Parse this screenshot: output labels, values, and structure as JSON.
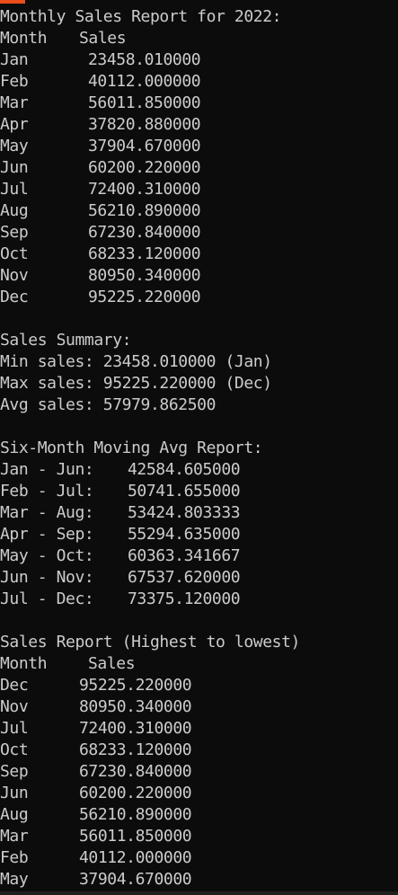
{
  "window": {
    "accent_color": "#e94e1b",
    "background": "#0c0c0c",
    "text_color": "#cccccc"
  },
  "monthly": {
    "heading": "Monthly Sales Report for 2022:",
    "col_month": "Month",
    "col_sales": "Sales",
    "rows": [
      {
        "month": "Jan",
        "sales": "23458.010000"
      },
      {
        "month": "Feb",
        "sales": "40112.000000"
      },
      {
        "month": "Mar",
        "sales": "56011.850000"
      },
      {
        "month": "Apr",
        "sales": "37820.880000"
      },
      {
        "month": "May",
        "sales": "37904.670000"
      },
      {
        "month": "Jun",
        "sales": "60200.220000"
      },
      {
        "month": "Jul",
        "sales": "72400.310000"
      },
      {
        "month": "Aug",
        "sales": "56210.890000"
      },
      {
        "month": "Sep",
        "sales": "67230.840000"
      },
      {
        "month": "Oct",
        "sales": "68233.120000"
      },
      {
        "month": "Nov",
        "sales": "80950.340000"
      },
      {
        "month": "Dec",
        "sales": "95225.220000"
      }
    ]
  },
  "summary": {
    "heading": "Sales Summary:",
    "min": "Min sales: 23458.010000 (Jan)",
    "max": "Max sales: 95225.220000 (Dec)",
    "avg": "Avg sales: 57979.862500"
  },
  "moving_avg": {
    "heading": "Six-Month Moving Avg Report:",
    "rows": [
      {
        "range": "Jan - Jun:",
        "value": "42584.605000"
      },
      {
        "range": "Feb - Jul:",
        "value": "50741.655000"
      },
      {
        "range": "Mar - Aug:",
        "value": "53424.803333"
      },
      {
        "range": "Apr - Sep:",
        "value": "55294.635000"
      },
      {
        "range": "May - Oct:",
        "value": "60363.341667"
      },
      {
        "range": "Jun - Nov:",
        "value": "67537.620000"
      },
      {
        "range": "Jul - Dec:",
        "value": "73375.120000"
      }
    ]
  },
  "sorted": {
    "heading": "Sales Report (Highest to lowest)",
    "col_month": "Month",
    "col_sales": "Sales",
    "rows": [
      {
        "month": "Dec",
        "sales": "95225.220000"
      },
      {
        "month": "Nov",
        "sales": "80950.340000"
      },
      {
        "month": "Jul",
        "sales": "72400.310000"
      },
      {
        "month": "Oct",
        "sales": "68233.120000"
      },
      {
        "month": "Sep",
        "sales": "67230.840000"
      },
      {
        "month": "Jun",
        "sales": "60200.220000"
      },
      {
        "month": "Aug",
        "sales": "56210.890000"
      },
      {
        "month": "Mar",
        "sales": "56011.850000"
      },
      {
        "month": "Feb",
        "sales": "40112.000000"
      },
      {
        "month": "May",
        "sales": "37904.670000"
      }
    ]
  }
}
